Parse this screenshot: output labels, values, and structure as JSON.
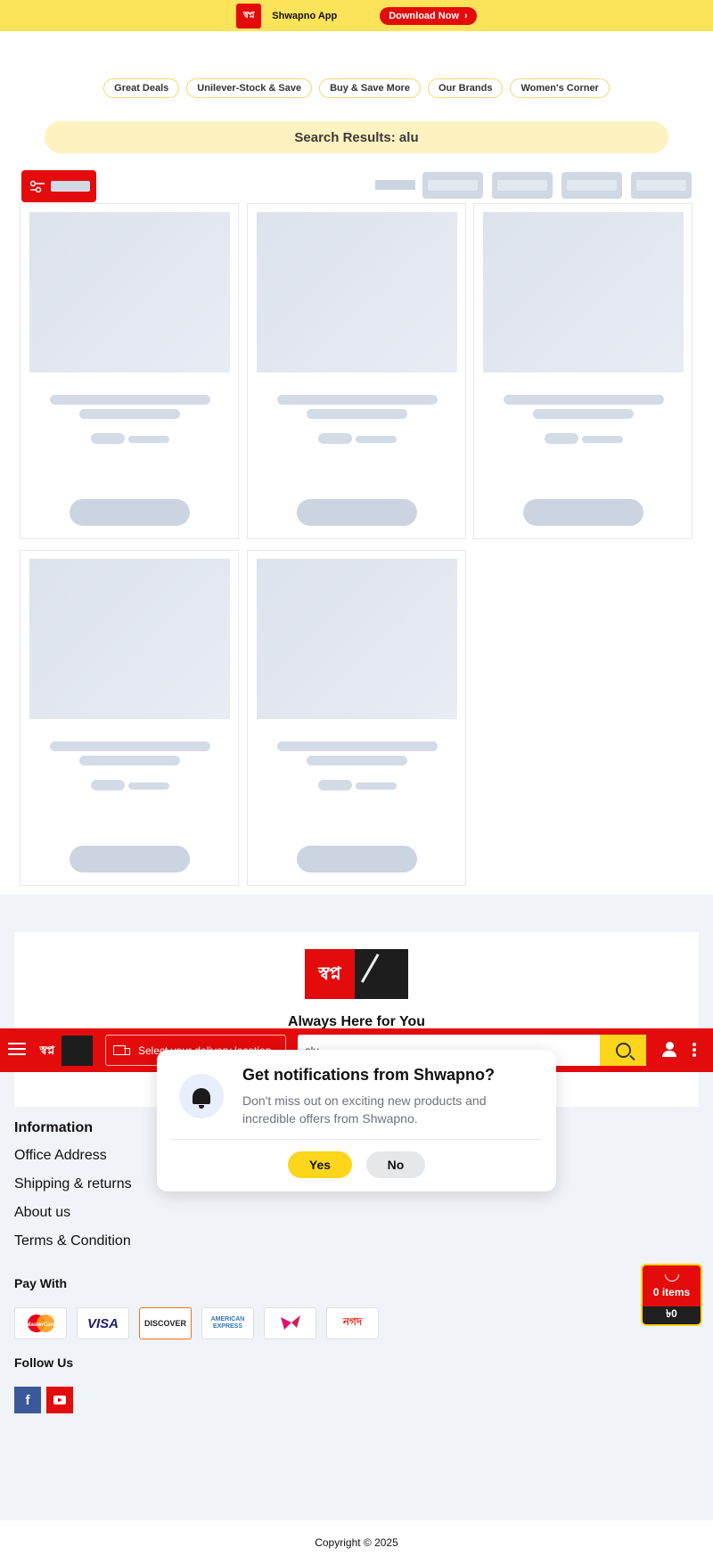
{
  "app_banner": {
    "logo_text": "স্বপ্ন",
    "app_name": "Shwapno App",
    "download_label": "Download Now",
    "download_icon": "chevron-right-icon"
  },
  "category_pills": [
    "Great Deals",
    "Unilever-Stock & Save",
    "Buy & Save More",
    "Our Brands",
    "Women's Corner"
  ],
  "search_results_label": "Search Results: alu",
  "products_loading": true,
  "header": {
    "logo_text": "স্বপ্ন",
    "location_label": "Select your delivery location",
    "search_value": "alu",
    "icons": [
      "hamburger-icon",
      "truck-icon",
      "search-icon",
      "user-icon",
      "kebab-menu-icon"
    ]
  },
  "notification": {
    "title": "Get notifications from Shwapno?",
    "body": "Don't miss out on exciting new products and incredible offers from Shwapno.",
    "yes_label": "Yes",
    "no_label": "No",
    "icon": "bell-icon"
  },
  "footer": {
    "logo_text": "স্বপ্ন",
    "tagline": "Always Here for You",
    "info_title": "Information",
    "info_links": [
      "Office Address",
      "Shipping & returns",
      "About us",
      "Terms & Condition"
    ],
    "pay_with_title": "Pay With",
    "payment_methods": [
      "MasterCard",
      "VISA",
      "DISCOVER",
      "AMERICAN EXPRESS",
      "bKash",
      "নগদ"
    ],
    "follow_us_title": "Follow Us",
    "social": [
      "facebook-icon",
      "youtube-icon"
    ],
    "copyright": "Copyright © 2025"
  },
  "cart": {
    "items_label": "0 items",
    "total": "৳0"
  },
  "colors": {
    "brand_red": "#e30b0b",
    "brand_yellow": "#fdd51a",
    "banner_yellow": "#fde35a"
  }
}
